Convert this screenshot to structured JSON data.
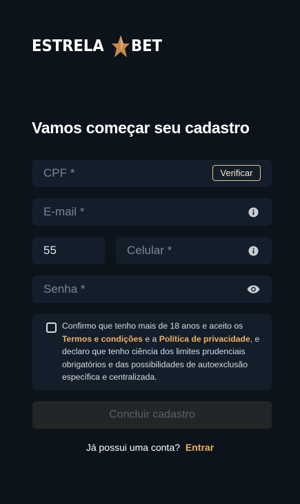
{
  "brand": {
    "logo_left": "ESTRELA",
    "logo_right": "BET",
    "accent_color": "#e0a055",
    "logo_icon": "star-icon"
  },
  "page": {
    "title": "Vamos começar seu cadastro"
  },
  "form": {
    "cpf_placeholder": "CPF *",
    "verify_label": "Verificar",
    "email_placeholder": "E-mail *",
    "email_icon": "info-icon",
    "country_code_value": "55",
    "phone_placeholder": "Celular *",
    "phone_icon": "info-icon",
    "password_placeholder": "Senha *",
    "password_icon": "eye-icon"
  },
  "consent": {
    "checked": false,
    "text_1": "Confirmo que tenho mais de 18 anos e aceito os",
    "terms_link": "Termos e condições",
    "text_2": "e a",
    "privacy_link": "Política de privacidade",
    "text_3": ", e declaro que tenho ciência dos limites prudenciais obrigatórios e das possibilidades de autoexclusão específica e centralizada."
  },
  "actions": {
    "submit_label": "Concluir cadastro",
    "login_prompt": "Já possui uma conta?",
    "login_link": "Entrar"
  }
}
